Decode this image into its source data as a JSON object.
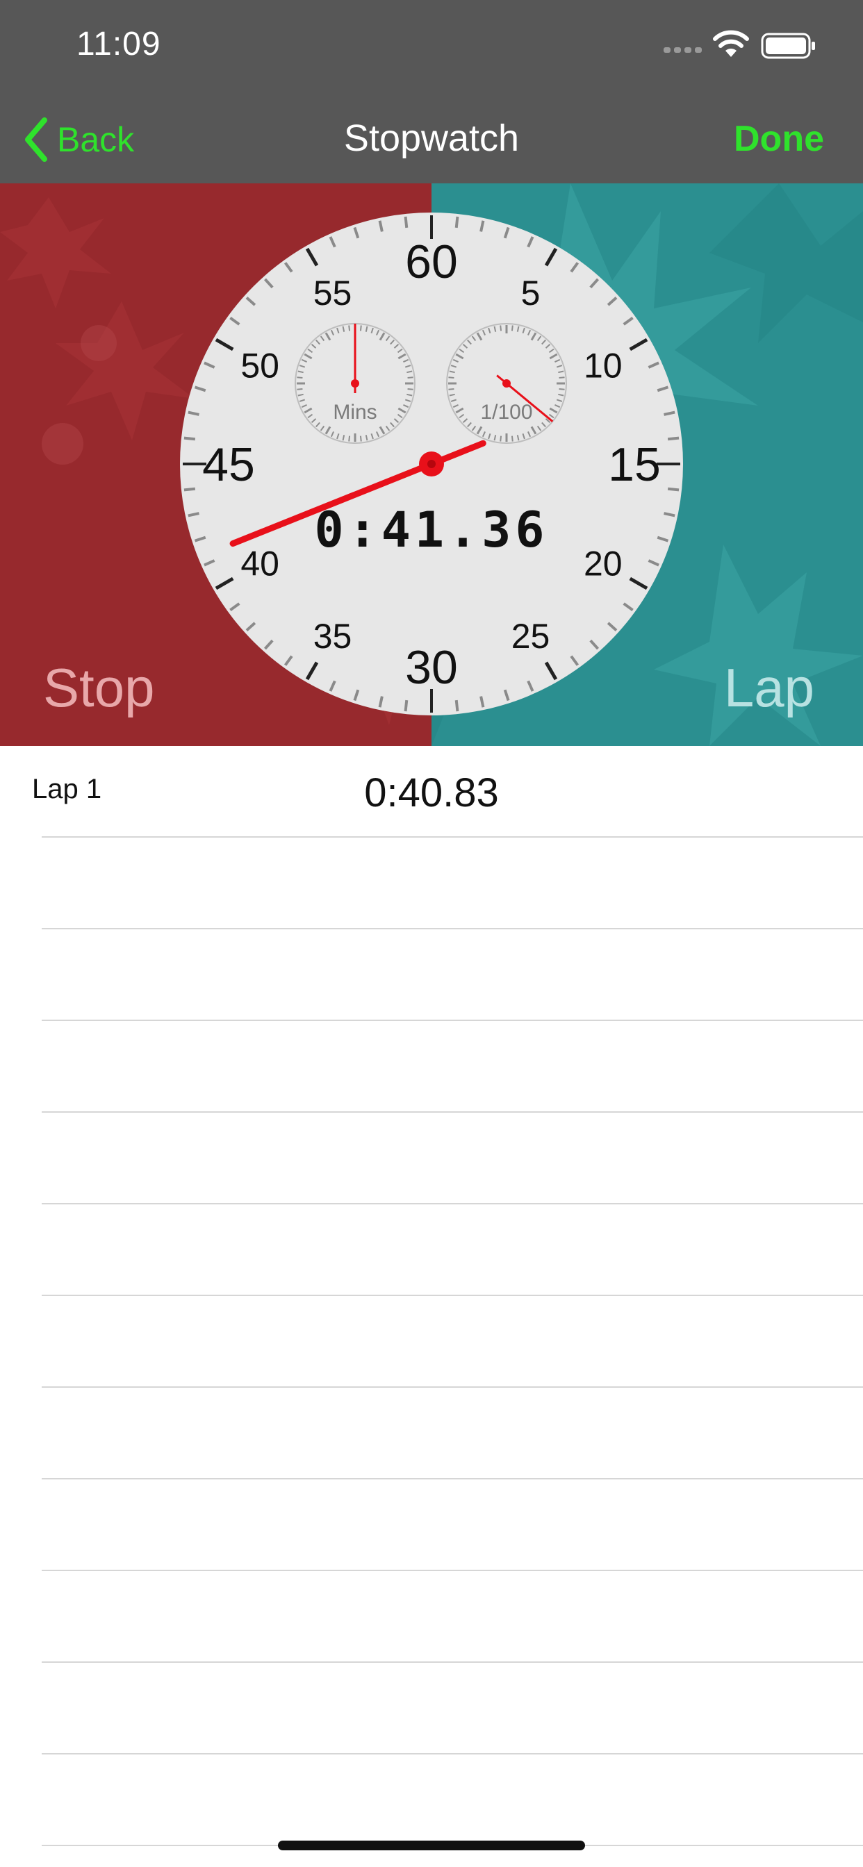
{
  "status_bar": {
    "time": "11:09"
  },
  "nav": {
    "back_label": "Back",
    "title": "Stopwatch",
    "done_label": "Done"
  },
  "colors": {
    "accent": "#2fe22c",
    "stop_panel": "#97292d",
    "lap_panel": "#2b8f90",
    "hand": "#e8101a"
  },
  "dial": {
    "major_labels": [
      "60",
      "15",
      "30",
      "45"
    ],
    "minor_labels": [
      "5",
      "10",
      "20",
      "25",
      "35",
      "40",
      "50",
      "55"
    ],
    "mins_subdial_label": "Mins",
    "hundredths_subdial_label": "1/100",
    "readout": "0:41.36",
    "second_value": 41.36,
    "minute_value": 0,
    "hundredths_value": 36
  },
  "buttons": {
    "stop_label": "Stop",
    "lap_label": "Lap"
  },
  "laps": [
    {
      "name": "Lap 1",
      "time": "0:40.83"
    }
  ],
  "empty_rows": 11
}
